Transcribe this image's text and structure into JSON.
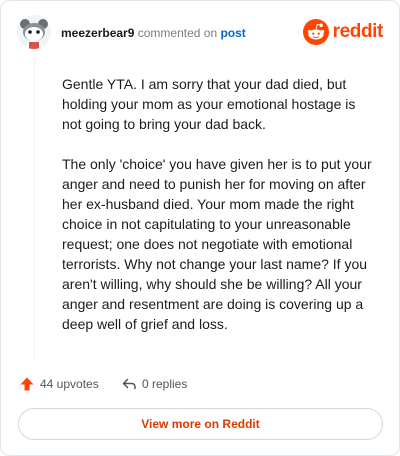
{
  "header": {
    "username": "meezerbear9",
    "action_text": "commented on",
    "post_link": "post",
    "brand_word": "reddit"
  },
  "comment": {
    "paragraphs": [
      "Gentle YTA. I am sorry that your dad died, but holding your mom as your emotional hostage is not going to bring your dad back.",
      "The only 'choice' you have given her is to put your anger and need to punish her for moving on after her ex-husband died. Your mom made the right choice in not capitulating to your unreasonable request; one does not negotiate with emotional terrorists. Why not change your last name? If you aren't willing, why should she be willing? All your anger and resentment are doing is covering up a deep well of grief and loss."
    ]
  },
  "footer": {
    "upvotes_label": "44 upvotes",
    "replies_label": "0 replies",
    "cta_label": "View more on Reddit"
  },
  "icons": {
    "avatar": "snoo-avatar-icon",
    "brand": "reddit-logo-icon",
    "upvote": "upvote-arrow-icon",
    "reply": "reply-arrow-icon"
  },
  "colors": {
    "brand": "#ff4500",
    "post_link": "#0a66c2",
    "upvote": "#ff4500",
    "cta_text": "#d93a00"
  }
}
